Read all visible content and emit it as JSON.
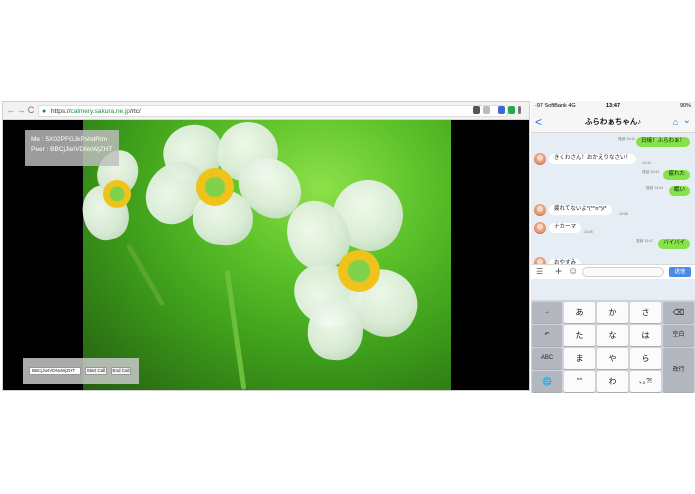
{
  "browser": {
    "url_scheme": "https://",
    "url_host": "calmery.sakura.ne.jp",
    "url_path": "/rtc/",
    "back_glyph": "←",
    "forward_glyph": "→",
    "reload_glyph": "C",
    "icons": [
      "back-icon",
      "forward-icon",
      "reload-icon",
      "lock-icon",
      "star-icon"
    ]
  },
  "call": {
    "me_label": "Me : 5X02PFGJkPshdRIm",
    "peer_label": "Peer : BBCjJieIVDNxWjZHT",
    "peer_input_value": "BBCjJieIVDNxWjZHT",
    "start_label": "Start Call",
    "end_label": "End Call"
  },
  "phone": {
    "status_left": "-97 SoftBank  4G",
    "status_time": "13:47",
    "status_right": "90%",
    "chat_title": "ふらわぁちゃん♪",
    "back_glyph": "<",
    "home_glyph": "⌂",
    "chevron_glyph": "⌄",
    "messages": [
      {
        "from": "me",
        "text": "日焼！ふらわぁ！",
        "meta": "既読 13:44"
      },
      {
        "from": "them",
        "text": "きくわさん！おかえりなさい！",
        "meta": "13:44"
      },
      {
        "from": "me",
        "text": "疲れた",
        "meta": "既読 13:44"
      },
      {
        "from": "me",
        "text": "眠い",
        "meta": "既読 13:44"
      },
      {
        "from": "them",
        "text": "疲れてないよ*(*^o^)/*",
        "meta": "13:45"
      },
      {
        "from": "them",
        "text": "ナカーマ",
        "meta": "13:45"
      },
      {
        "from": "me",
        "text": "バイバイ",
        "meta": "既読 13:47"
      },
      {
        "from": "them",
        "text": "おやすみ",
        "meta": ""
      }
    ],
    "send_label": "送信",
    "keyboard": {
      "row1": [
        "→",
        "あ",
        "か",
        "さ",
        "⌫"
      ],
      "row2": [
        "↶",
        "た",
        "な",
        "は",
        "空白"
      ],
      "row3": [
        "ABC",
        "ま",
        "や",
        "ら",
        "改行"
      ],
      "row4": [
        "🌐",
        "^^",
        "わ",
        "､｡?!"
      ]
    }
  },
  "colors": {
    "line_green": "#85e249",
    "ios_blue": "#1a73e8",
    "send_blue": "#4a8be8"
  }
}
